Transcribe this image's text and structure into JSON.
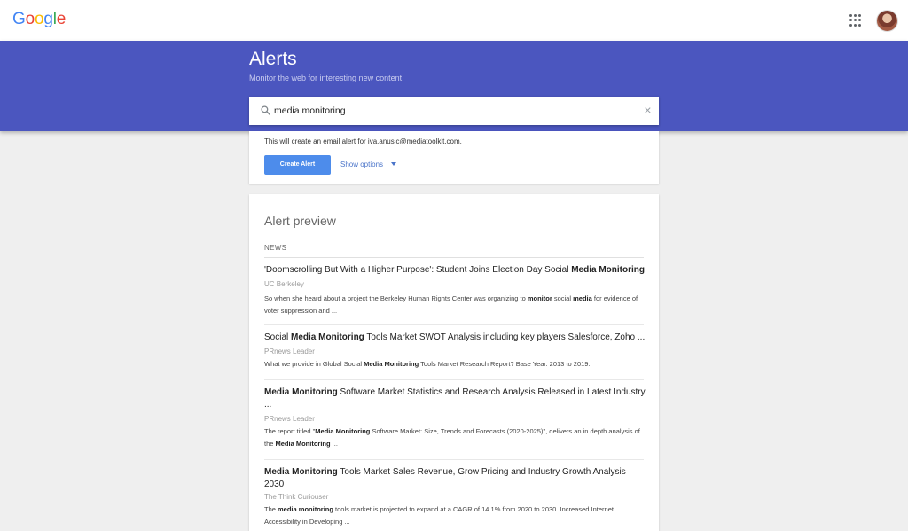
{
  "header": {
    "logo_text": "Google",
    "logo_colors": [
      "#4285f4",
      "#ea4335",
      "#fbbc05",
      "#4285f4",
      "#34a853",
      "#ea4335"
    ]
  },
  "banner": {
    "title": "Alerts",
    "subtitle": "Monitor the web for interesting new content",
    "background": "#4b56bf"
  },
  "search": {
    "value": "media monitoring",
    "clear_icon": "×"
  },
  "options": {
    "note": "This will create an email alert for iva.anusic@mediatoolkit.com.",
    "create_label": "Create Alert",
    "show_options_label": "Show options"
  },
  "preview": {
    "title": "Alert preview",
    "section": "NEWS",
    "items": [
      {
        "title": [
          [
            "'Doomscrolling But With a Higher Purpose': Student Joins Election Day Social ",
            false
          ],
          [
            "Media Monitoring",
            true
          ]
        ],
        "source": "UC Berkeley",
        "snippet": [
          [
            "So when she heard about a project the Berkeley Human Rights Center was organizing to ",
            false
          ],
          [
            "monitor",
            true
          ],
          [
            " social ",
            false
          ],
          [
            "media",
            true
          ],
          [
            " for evidence of voter suppression and ...",
            false
          ]
        ]
      },
      {
        "title": [
          [
            "Social ",
            false
          ],
          [
            "Media Monitoring",
            true
          ],
          [
            " Tools Market SWOT Analysis including key players Salesforce, Zoho ...",
            false
          ]
        ],
        "source": "PRnews Leader",
        "snippet": [
          [
            "What we provide in Global Social ",
            false
          ],
          [
            "Media Monitoring",
            true
          ],
          [
            " Tools Market Research Report? Base Year. 2013 to 2019.",
            false
          ]
        ]
      },
      {
        "title": [
          [
            "Media Monitoring",
            true
          ],
          [
            " Software Market Statistics and Research Analysis Released in Latest Industry ...",
            false
          ]
        ],
        "source": "PRnews Leader",
        "snippet": [
          [
            "The report titled \"",
            false
          ],
          [
            "Media Monitoring",
            true
          ],
          [
            " Software Market: Size, Trends and Forecasts (2020-2025)\", delivers an in depth analysis of the ",
            false
          ],
          [
            "Media Monitoring",
            true
          ],
          [
            " ...",
            false
          ]
        ]
      },
      {
        "title": [
          [
            "Media Monitoring",
            true
          ],
          [
            " Tools Market Sales Revenue, Grow Pricing and Industry Growth Analysis 2030",
            false
          ]
        ],
        "source": "The Think Curiouser",
        "snippet": [
          [
            "The ",
            false
          ],
          [
            "media monitoring",
            true
          ],
          [
            " tools market is projected to expand at a CAGR of 14.1% from 2020 to 2030. Increased Internet Accessibility in Developing ...",
            false
          ]
        ]
      }
    ]
  }
}
